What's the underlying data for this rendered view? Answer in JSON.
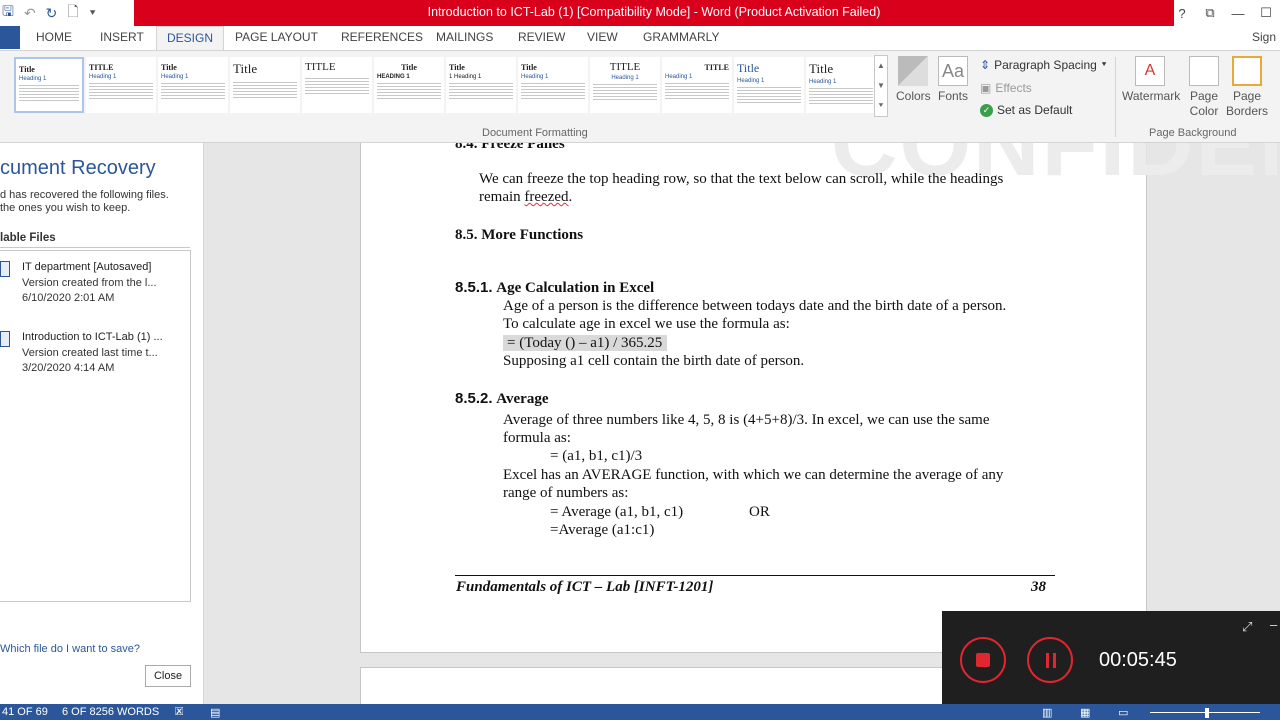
{
  "window": {
    "title": "Introduction to ICT-Lab (1) [Compatibility Mode] -  Word (Product Activation Failed)",
    "controls": [
      "?",
      "⧉",
      "—",
      "☐"
    ]
  },
  "tabs": {
    "items": [
      "HOME",
      "INSERT",
      "DESIGN",
      "PAGE LAYOUT",
      "REFERENCES",
      "MAILINGS",
      "REVIEW",
      "VIEW",
      "GRAMMARLY"
    ],
    "active": "DESIGN",
    "signin": "Sign"
  },
  "ribbon": {
    "gallery": [
      {
        "title": "Title",
        "heading": "Heading 1"
      },
      {
        "title": "TITLE",
        "heading": "Heading 1"
      },
      {
        "title": "Title",
        "heading": "Heading 1"
      },
      {
        "title": "Title",
        "heading": ""
      },
      {
        "title": "TITLE",
        "heading": ""
      },
      {
        "title": "Title",
        "heading": "HEADING 1"
      },
      {
        "title": "Title",
        "heading": "1  Heading 1"
      },
      {
        "title": "Title",
        "heading": "Heading 1"
      },
      {
        "title": "TITLE",
        "heading": "Heading 1"
      },
      {
        "title": "TITLE",
        "heading": "Heading 1"
      },
      {
        "title": "Title",
        "heading": "Heading 1"
      },
      {
        "title": "Title",
        "heading": "Heading 1"
      }
    ],
    "colors_label": "Colors",
    "fonts_label": "Fonts",
    "paragraph_spacing_label": "Paragraph Spacing",
    "effects_label": "Effects",
    "set_default_label": "Set as Default",
    "document_formatting_label": "Document Formatting",
    "watermark_label": "Watermark",
    "page_color_label": "Page Color",
    "page_borders_label": "Page Borders",
    "page_background_label": "Page Background"
  },
  "recovery": {
    "title": "cument Recovery",
    "desc_line1": "d has recovered the following files.",
    "desc_line2": " the ones you wish to keep.",
    "available_label": "lable Files",
    "files": [
      {
        "name": "IT department  [Autosaved]",
        "version": "Version created from the l...",
        "date": "6/10/2020 2:01 AM"
      },
      {
        "name": "Introduction to ICT-Lab (1) ...",
        "version": "Version created last time t...",
        "date": "3/20/2020 4:14 AM"
      }
    ],
    "which_file_link": "Which file do I want to save?",
    "close_label": "Close"
  },
  "document": {
    "watermark": "CONFIDENTIAL",
    "h84": "8.4. Freeze Panes",
    "p84_line1": "We can freeze the top heading row, so that the text below can scroll, while the headings",
    "p84_line2_pre": "remain ",
    "p84_line2_word": "freezed",
    "p84_line2_post": ".",
    "h85": "8.5. More Functions",
    "h851_num": "8.5.1.",
    "h851_title": "Age Calculation in Excel",
    "p851_line1": "Age of a person is the difference between todays date and the birth date of a person.",
    "p851_line2": "To calculate age in excel we use the formula as:",
    "p851_formula": "= (Today () – a1) / 365.25",
    "p851_line3": "Supposing a1 cell contain the birth date of person.",
    "h852_num": "8.5.2.",
    "h852_title": "Average",
    "p852_line1": "Average of three numbers like 4, 5, 8 is (4+5+8)/3. In excel, we can use the same",
    "p852_line2": "formula as:",
    "p852_formula1": "= (a1, b1, c1)/3",
    "p852_line3": "Excel has an AVERAGE function, with which we can determine the average of any",
    "p852_line4": "range of numbers as:",
    "p852_formula2": "= Average (a1, b1, c1)",
    "p852_or": "OR",
    "p852_formula3": "=Average (a1:c1)",
    "footer_text": "Fundamentals of ICT – Lab [INFT-1201]",
    "footer_page": "38"
  },
  "recorder": {
    "time": "00:05:45"
  },
  "status": {
    "page": "41 OF 69",
    "words": "6 OF 8256 WORDS"
  }
}
